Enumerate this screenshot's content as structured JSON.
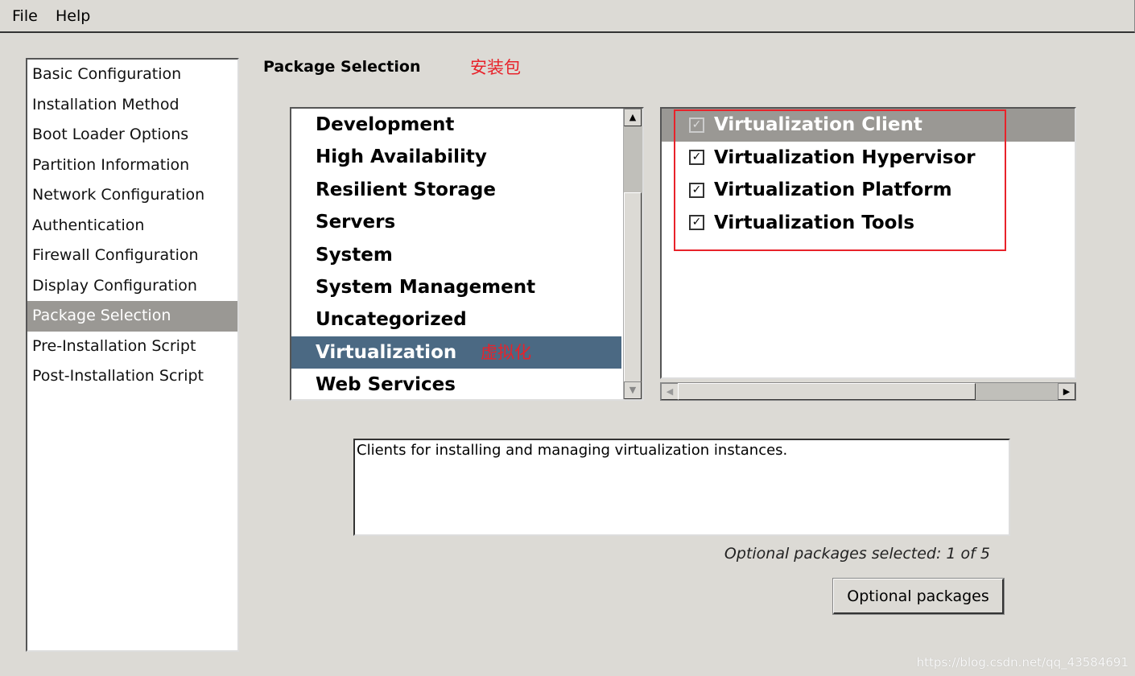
{
  "menu": {
    "file": "File",
    "help": "Help"
  },
  "nav": {
    "items": [
      "Basic Configuration",
      "Installation Method",
      "Boot Loader Options",
      "Partition Information",
      "Network Configuration",
      "Authentication",
      "Firewall Configuration",
      "Display Configuration",
      "Package Selection",
      "Pre-Installation Script",
      "Post-Installation Script"
    ],
    "selected": "Package Selection"
  },
  "page": {
    "title": "Package Selection",
    "annotation_title": "安装包",
    "annotation_group": "虚拟化"
  },
  "groups": {
    "items": [
      "Development",
      "High Availability",
      "Resilient Storage",
      "Servers",
      "System",
      "System Management",
      "Uncategorized",
      "Virtualization",
      "Web Services"
    ],
    "selected": "Virtualization"
  },
  "packages": {
    "items": [
      {
        "label": "Virtualization Client",
        "checked": true,
        "selected": true
      },
      {
        "label": "Virtualization Hypervisor",
        "checked": true
      },
      {
        "label": "Virtualization Platform",
        "checked": true
      },
      {
        "label": "Virtualization Tools",
        "checked": true
      }
    ]
  },
  "description": "Clients for installing and managing virtualization instances.",
  "optional_count": "Optional packages selected: 1 of 5",
  "optional_button": "Optional packages",
  "watermark": "https://blog.csdn.net/qq_43584691",
  "colors": {
    "selection": "#4b6983",
    "annotation": "#e8222a"
  }
}
